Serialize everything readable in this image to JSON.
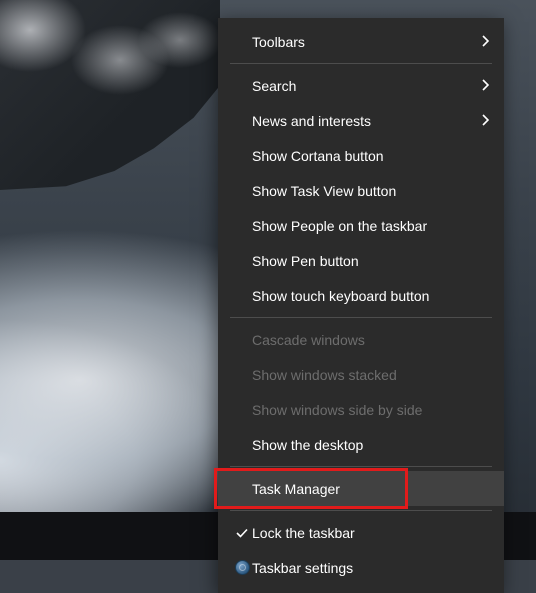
{
  "menu": {
    "groups": [
      [
        {
          "id": "toolbars",
          "label": "Toolbars",
          "submenu": true
        }
      ],
      [
        {
          "id": "search",
          "label": "Search",
          "submenu": true
        },
        {
          "id": "news",
          "label": "News and interests",
          "submenu": true
        },
        {
          "id": "cortana",
          "label": "Show Cortana button"
        },
        {
          "id": "taskview",
          "label": "Show Task View button"
        },
        {
          "id": "people",
          "label": "Show People on the taskbar"
        },
        {
          "id": "pen",
          "label": "Show Pen button"
        },
        {
          "id": "touchkb",
          "label": "Show touch keyboard button"
        }
      ],
      [
        {
          "id": "cascade",
          "label": "Cascade windows",
          "disabled": true
        },
        {
          "id": "stacked",
          "label": "Show windows stacked",
          "disabled": true
        },
        {
          "id": "sidebyside",
          "label": "Show windows side by side",
          "disabled": true
        },
        {
          "id": "desktop",
          "label": "Show the desktop"
        }
      ],
      [
        {
          "id": "taskmgr",
          "label": "Task Manager",
          "hover": true,
          "highlighted": true
        }
      ],
      [
        {
          "id": "lock",
          "label": "Lock the taskbar",
          "checked": true
        },
        {
          "id": "settings",
          "label": "Taskbar settings",
          "icon": "gear"
        }
      ]
    ]
  },
  "colors": {
    "highlight": "#e11b1b"
  }
}
